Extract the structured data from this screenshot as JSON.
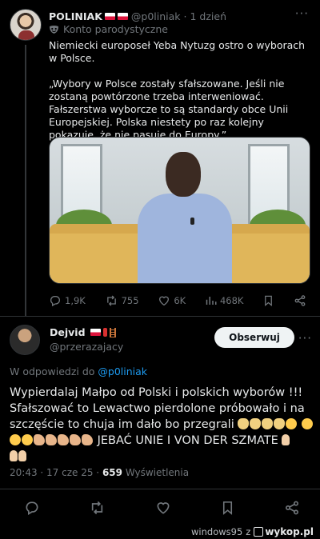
{
  "tweet": {
    "author_name": "POLINIAK",
    "handle": "@p0liniak",
    "time": "· 1 dzień",
    "parody_label": "Konto parodystyczne",
    "intro": "Niemiecki europoseł Yeba Nytuzg ostro o wyborach w Polsce.",
    "quote": "„Wybory w Polsce zostały sfałszowane. Jeśli nie zostaną powtórzone trzeba interweniować. Fałszerstwa wyborcze to są standardy obce Unii Europejskiej. Polska niestety po raz kolejny pokazuje, że nie pasuje do Europy.”",
    "stats": {
      "replies": "1,9K",
      "reposts": "755",
      "likes": "6K",
      "views": "468K"
    }
  },
  "reply": {
    "author_name": "Dejvid",
    "handle": "@przerazajacy",
    "follow_label": "Obserwuj",
    "reply_to_prefix": "W odpowiedzi do",
    "reply_to_handle": "@p0liniak",
    "text_main": "Wypierdalaj Małpo od Polski i polskich wyborów !!! Sfałszować to Lewactwo pierdolone próbowało i na szczęście to chuja im dało bo przegrali",
    "text_tail": "JEBAĆ UNIE I VON DER SZMATE",
    "time": "20:43 · 17 cze 25 ·",
    "views_count": "659",
    "views_label": "Wyświetlenia"
  },
  "watermark": {
    "user": "windows95",
    "conj": "z",
    "site": "wykop.pl"
  },
  "icons": [
    "more-icon",
    "parody-mask-icon",
    "reply-icon",
    "repost-icon",
    "like-icon",
    "views-icon",
    "bookmark-icon",
    "share-icon"
  ]
}
